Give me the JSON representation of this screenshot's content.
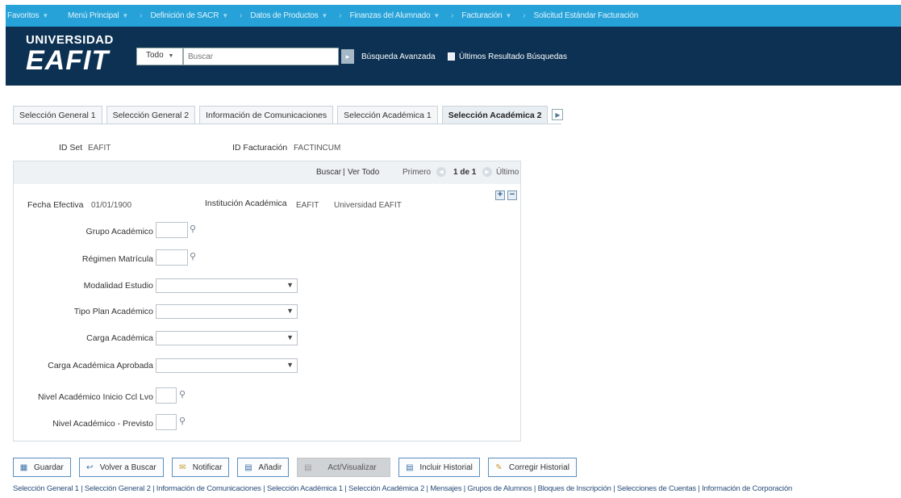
{
  "topnav": {
    "items": [
      {
        "label": "Favoritos",
        "caret": true
      },
      {
        "label": "Menú Principal",
        "caret": true
      },
      {
        "label": "Definición de SACR",
        "caret": true
      },
      {
        "label": "Datos de Productos",
        "caret": true
      },
      {
        "label": "Finanzas del Alumnado",
        "caret": true
      },
      {
        "label": "Facturación",
        "caret": true
      },
      {
        "label": "Solicitud Estándar Facturación",
        "caret": false
      }
    ],
    "caret_glyph": "▼",
    "separator_glyph": "›"
  },
  "header": {
    "logo_line1": "UNIVERSIDAD",
    "logo_line2": "EAFIT",
    "search_scope": "Todo",
    "search_placeholder": "Buscar",
    "advanced_search": "Búsqueda Avanzada",
    "last_results": "Últimos Resultado Búsquedas"
  },
  "tabs": [
    {
      "label": "Selección General 1",
      "active": false
    },
    {
      "label": "Selección General 2",
      "active": false
    },
    {
      "label": "Información de Comunicaciones",
      "active": false
    },
    {
      "label": "Selección Académica 1",
      "active": false
    },
    {
      "label": "Selección Académica 2",
      "active": true
    }
  ],
  "ids": {
    "set_label": "ID Set",
    "set_value": "EAFIT",
    "billing_label": "ID Facturación",
    "billing_value": "FACTINCUM"
  },
  "panel": {
    "search_link": "Buscar",
    "view_all_link": "Ver Todo",
    "sep": "|",
    "first": "Primero",
    "counter": "1 de 1",
    "last": "Último",
    "effective_date_label": "Fecha Efectiva",
    "effective_date_value": "01/01/1900",
    "institution_label": "Institución Académica",
    "institution_code": "EAFIT",
    "institution_name": "Universidad EAFIT",
    "fields": {
      "grupo_label": "Grupo Académico",
      "regimen_label": "Régimen Matrícula",
      "modalidad_label": "Modalidad Estudio",
      "tipo_plan_label": "Tipo Plan Académico",
      "carga_label": "Carga Académica",
      "carga_aprobada_label": "Carga Académica Aprobada",
      "nivel_inicio_label": "Nivel Académico Inicio Ccl Lvo",
      "nivel_previsto_label": "Nivel Académico - Previsto"
    }
  },
  "toolbar": {
    "save": "Guardar",
    "back": "Volver a Buscar",
    "notify": "Notificar",
    "add": "Añadir",
    "update": "Act/Visualizar",
    "history": "Incluir Historial",
    "correct": "Corregir Historial"
  },
  "footer_links": "Selección General 1 | Selección General 2 | Información de Comunicaciones | Selección Académica 1 | Selección Académica 2 | Mensajes | Grupos de Alumnos | Bloques de Inscripción | Selecciones de Cuentas | Información de Corporación"
}
